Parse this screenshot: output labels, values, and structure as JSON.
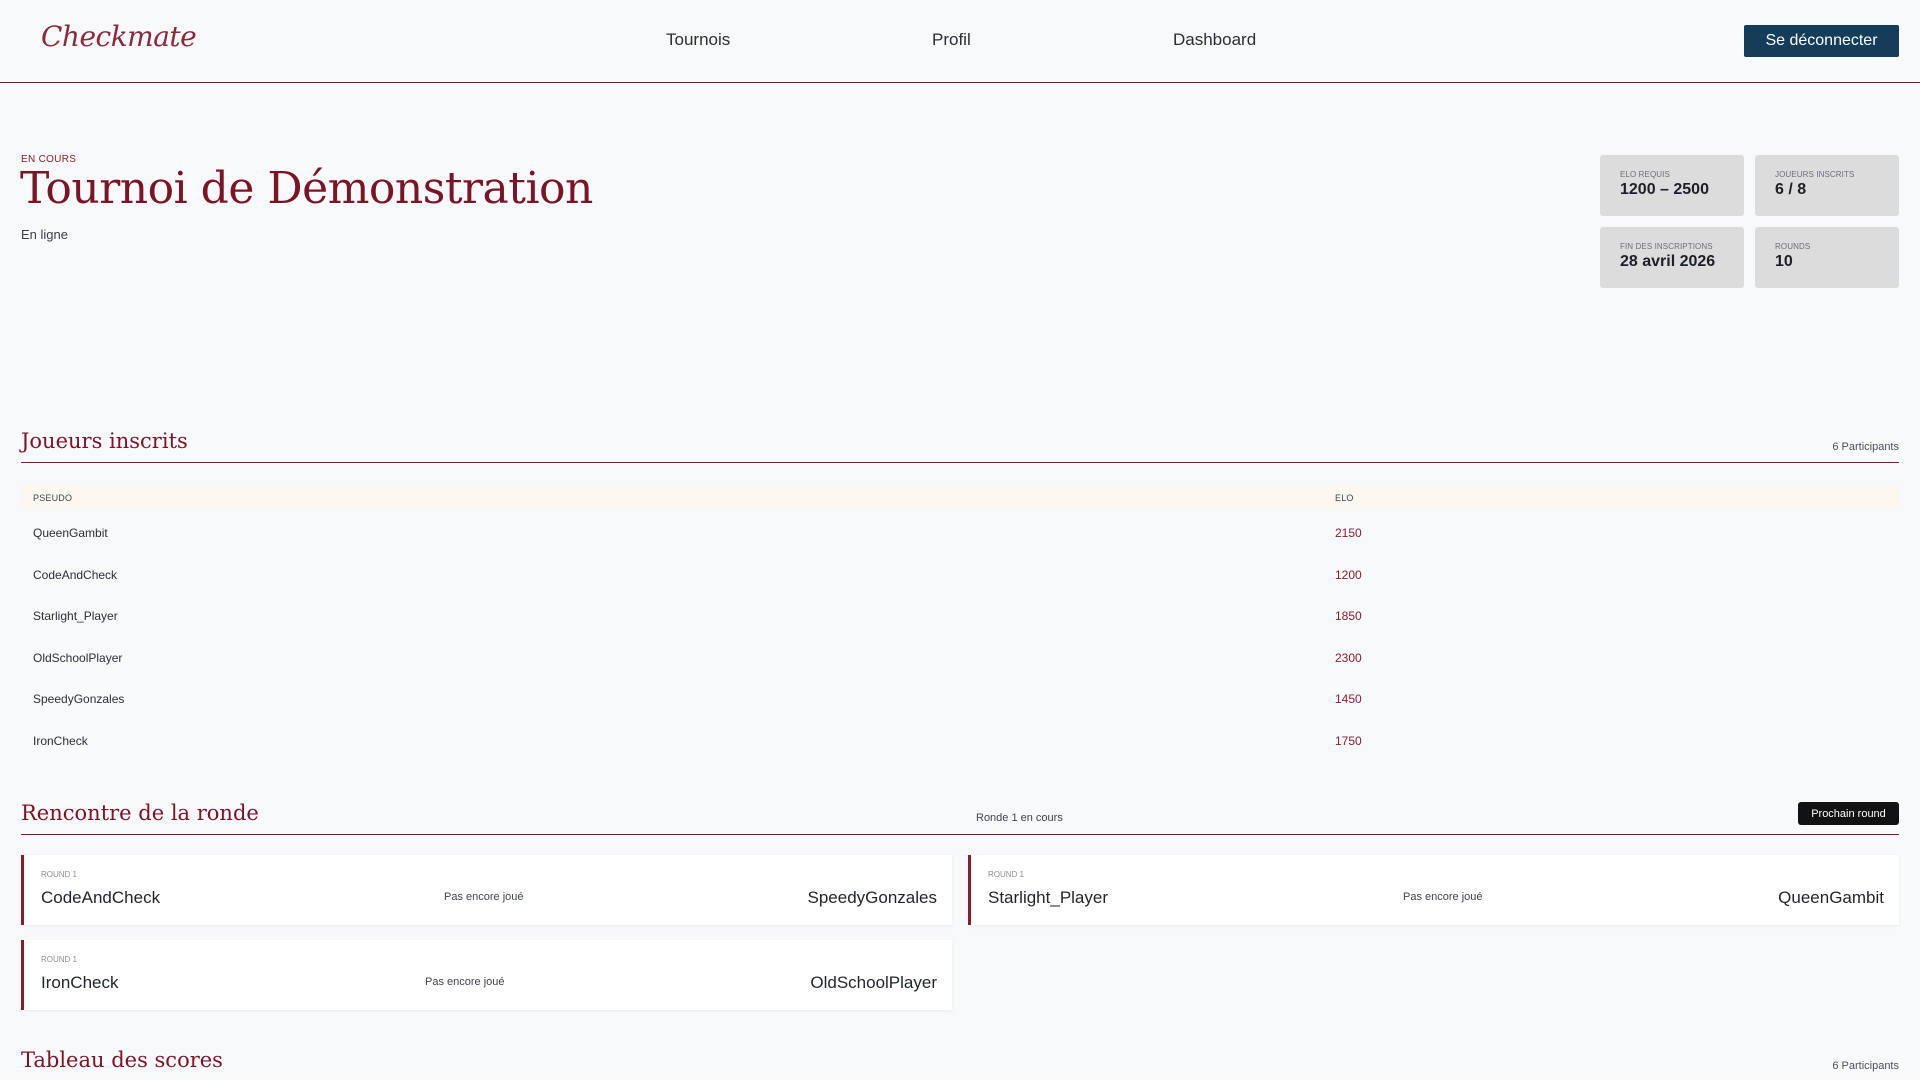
{
  "header": {
    "logo": "Checkmate",
    "nav": [
      "Tournois",
      "Profil",
      "Dashboard"
    ],
    "logout_label": "Se déconnecter"
  },
  "tournament": {
    "status": "EN COURS",
    "title": "Tournoi de Démonstration",
    "location": "En ligne",
    "stats": [
      {
        "label": "ELO REQUIS",
        "value": "1200 – 2500"
      },
      {
        "label": "JOUEURS INSCRITS",
        "value": "6 / 8"
      },
      {
        "label": "FIN DES INSCRIPTIONS",
        "value": "28 avril 2026"
      },
      {
        "label": "ROUNDS",
        "value": "10"
      }
    ]
  },
  "players_section": {
    "title": "Joueurs inscrits",
    "count": "6 Participants",
    "columns": [
      "PSEUDO",
      "ELO"
    ],
    "rows": [
      {
        "name": "QueenGambit",
        "elo": "2150"
      },
      {
        "name": "CodeAndCheck",
        "elo": "1200"
      },
      {
        "name": "Starlight_Player",
        "elo": "1850"
      },
      {
        "name": "OldSchoolPlayer",
        "elo": "2300"
      },
      {
        "name": "SpeedyGonzales",
        "elo": "1450"
      },
      {
        "name": "IronCheck",
        "elo": "1750"
      }
    ]
  },
  "round_section": {
    "title": "Rencontre de la ronde",
    "meta": "Ronde 1 en cours",
    "next_label": "Prochain round",
    "matches": [
      {
        "round": "ROUND 1",
        "p1": "CodeAndCheck",
        "status": "Pas encore joué",
        "p2": "SpeedyGonzales"
      },
      {
        "round": "ROUND 1",
        "p1": "Starlight_Player",
        "status": "Pas encore joué",
        "p2": "QueenGambit"
      },
      {
        "round": "ROUND 1",
        "p1": "IronCheck",
        "status": "Pas encore joué",
        "p2": "OldSchoolPlayer"
      }
    ]
  },
  "scores_section": {
    "title": "Tableau des scores",
    "count": "6 Participants"
  },
  "colors": {
    "accent": "#7b1425",
    "logout_bg": "#143d5a",
    "next_round_bg": "#121212",
    "stat_card_bg": "#dcdcdc"
  }
}
